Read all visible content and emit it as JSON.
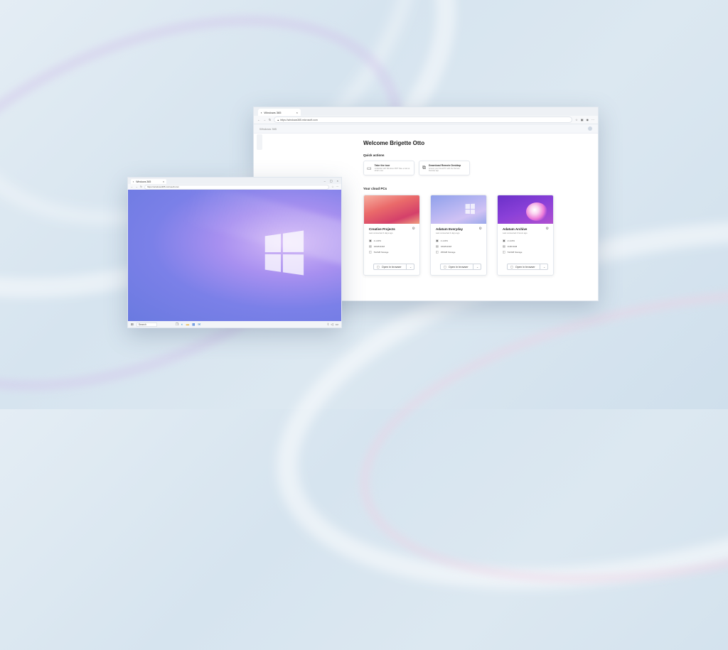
{
  "back_window": {
    "tab_label": "Windows 365",
    "url": "https://windows365.microsoft.com",
    "app_header": "Windows 365",
    "welcome": "Welcome Brigette Otto",
    "quick_actions_title": "Quick actions",
    "quick_actions": [
      {
        "title": "Take the tour",
        "desc": "Unfamiliar with Windows 365? Take a look at what's new"
      },
      {
        "title": "Download Remote Desktop",
        "desc": "Access your Cloud PC with the Remote Desktop app"
      }
    ],
    "cloud_pcs_title": "Your cloud PCs",
    "cloud_pcs": [
      {
        "name": "Creative Projects",
        "sub": "Last connected 4 days ago",
        "cpu": "4 vCPU",
        "ram": "32GB RAM",
        "storage": "512GB Storage",
        "open_label": "Open in browser"
      },
      {
        "name": "Adatum Everyday",
        "sub": "Last connected 4 days ago",
        "cpu": "4 vCPU",
        "ram": "16GB RAM",
        "storage": "256GB Storage",
        "open_label": "Open in browser"
      },
      {
        "name": "Adatum Archive",
        "sub": "Last connected 4 hours ago",
        "cpu": "2 vCPU",
        "ram": "4GB RAM",
        "storage": "512GB Storage",
        "open_label": "Open in browser"
      }
    ]
  },
  "front_window": {
    "tab_label": "Windows 365",
    "url": "https://windows365.microsoft.com",
    "search_placeholder": "Search"
  },
  "icons": {
    "cpu": "cpu-icon",
    "ram": "ram-icon",
    "storage": "storage-icon",
    "gear": "gear-icon",
    "windows": "windows-logo-icon"
  }
}
